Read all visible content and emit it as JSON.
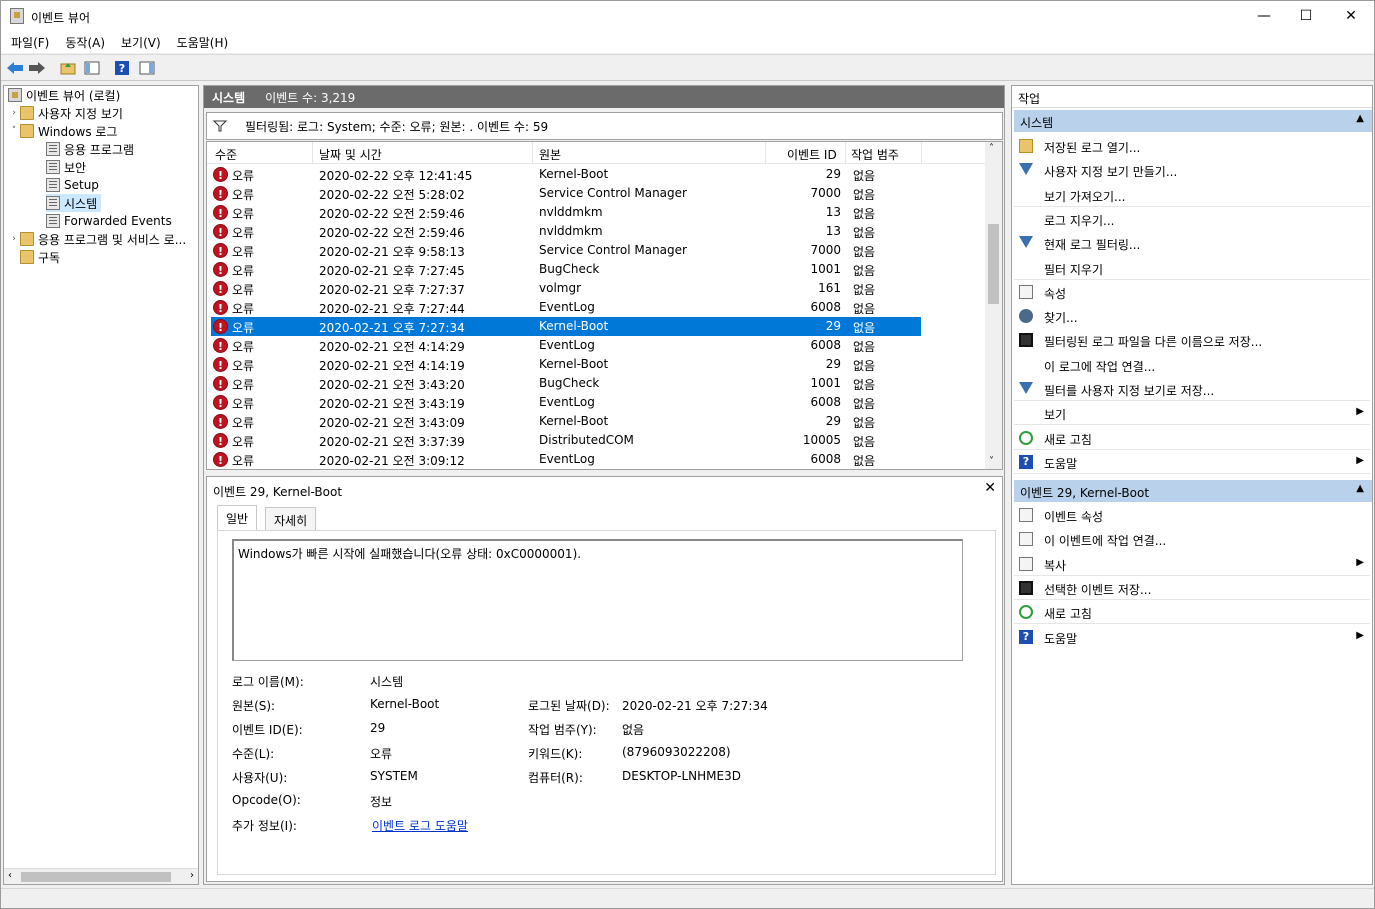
{
  "window": {
    "title": "이벤트 뷰어",
    "controls": [
      "—",
      "☐",
      "✕"
    ]
  },
  "menu": [
    "파일(F)",
    "동작(A)",
    "보기(V)",
    "도움말(H)"
  ],
  "tree": {
    "root": "이벤트 뷰어 (로컬)",
    "custom_views": "사용자 지정 보기",
    "windows_logs": "Windows 로그",
    "logs": [
      "응용 프로그램",
      "보안",
      "Setup",
      "시스템",
      "Forwarded Events"
    ],
    "app_services": "응용 프로그램 및 서비스 로...",
    "subscriptions": "구독"
  },
  "center": {
    "pane_name": "시스템",
    "event_count": "이벤트 수: 3,219",
    "filter_text": "필터링됨: 로그: System; 수준: 오류; 원본: . 이벤트 수: 59",
    "columns": [
      "수준",
      "날짜 및 시간",
      "원본",
      "이벤트 ID",
      "작업 범주"
    ],
    "rows": [
      {
        "level": "오류",
        "date": "2020-02-22 오후 12:41:45",
        "source": "Kernel-Boot",
        "id": "29",
        "cat": "없음"
      },
      {
        "level": "오류",
        "date": "2020-02-22 오전 5:28:02",
        "source": "Service Control Manager",
        "id": "7000",
        "cat": "없음"
      },
      {
        "level": "오류",
        "date": "2020-02-22 오전 2:59:46",
        "source": "nvlddmkm",
        "id": "13",
        "cat": "없음"
      },
      {
        "level": "오류",
        "date": "2020-02-22 오전 2:59:46",
        "source": "nvlddmkm",
        "id": "13",
        "cat": "없음"
      },
      {
        "level": "오류",
        "date": "2020-02-21 오후 9:58:13",
        "source": "Service Control Manager",
        "id": "7000",
        "cat": "없음"
      },
      {
        "level": "오류",
        "date": "2020-02-21 오후 7:27:45",
        "source": "BugCheck",
        "id": "1001",
        "cat": "없음"
      },
      {
        "level": "오류",
        "date": "2020-02-21 오후 7:27:37",
        "source": "volmgr",
        "id": "161",
        "cat": "없음"
      },
      {
        "level": "오류",
        "date": "2020-02-21 오후 7:27:44",
        "source": "EventLog",
        "id": "6008",
        "cat": "없음"
      },
      {
        "level": "오류",
        "date": "2020-02-21 오후 7:27:34",
        "source": "Kernel-Boot",
        "id": "29",
        "cat": "없음"
      },
      {
        "level": "오류",
        "date": "2020-02-21 오전 4:14:29",
        "source": "EventLog",
        "id": "6008",
        "cat": "없음"
      },
      {
        "level": "오류",
        "date": "2020-02-21 오전 4:14:19",
        "source": "Kernel-Boot",
        "id": "29",
        "cat": "없음"
      },
      {
        "level": "오류",
        "date": "2020-02-21 오전 3:43:20",
        "source": "BugCheck",
        "id": "1001",
        "cat": "없음"
      },
      {
        "level": "오류",
        "date": "2020-02-21 오전 3:43:19",
        "source": "EventLog",
        "id": "6008",
        "cat": "없음"
      },
      {
        "level": "오류",
        "date": "2020-02-21 오전 3:43:09",
        "source": "Kernel-Boot",
        "id": "29",
        "cat": "없음"
      },
      {
        "level": "오류",
        "date": "2020-02-21 오전 3:37:39",
        "source": "DistributedCOM",
        "id": "10005",
        "cat": "없음"
      },
      {
        "level": "오류",
        "date": "2020-02-21 오전 3:09:12",
        "source": "EventLog",
        "id": "6008",
        "cat": "없음"
      }
    ],
    "selected_row": 8
  },
  "detail": {
    "title": "이벤트 29, Kernel-Boot",
    "tabs": [
      "일반",
      "자세히"
    ],
    "description": "Windows가 빠른 시작에 실패했습니다(오류 상태: 0xC0000001).",
    "fields": {
      "log_name_label": "로그 이름(M):",
      "log_name": "시스템",
      "source_label": "원본(S):",
      "source": "Kernel-Boot",
      "logged_label": "로그된 날짜(D):",
      "logged": "2020-02-21 오후 7:27:34",
      "event_id_label": "이벤트 ID(E):",
      "event_id": "29",
      "task_label": "작업 범주(Y):",
      "task": "없음",
      "level_label": "수준(L):",
      "level": "오류",
      "keywords_label": "키워드(K):",
      "keywords": "(8796093022208)",
      "user_label": "사용자(U):",
      "user": "SYSTEM",
      "computer_label": "컴퓨터(R):",
      "computer": "DESKTOP-LNHME3D",
      "opcode_label": "Opcode(O):",
      "opcode": "정보",
      "more_label": "추가 정보(I):",
      "more_link": "이벤트 로그 도움말"
    }
  },
  "actions": {
    "header": "작업",
    "section1": "시스템",
    "items1": [
      "저장된 로그 열기...",
      "사용자 지정 보기 만들기...",
      "보기 가져오기...",
      "로그 지우기...",
      "현재 로그 필터링...",
      "필터 지우기",
      "속성",
      "찾기...",
      "필터링된 로그 파일을 다른 이름으로 저장...",
      "이 로그에 작업 연결...",
      "필터를 사용자 지정 보기로 저장...",
      "보기",
      "새로 고침",
      "도움말"
    ],
    "section2": "이벤트 29, Kernel-Boot",
    "items2": [
      "이벤트 속성",
      "이 이벤트에 작업 연결...",
      "복사",
      "선택한 이벤트 저장...",
      "새로 고침",
      "도움말"
    ]
  }
}
